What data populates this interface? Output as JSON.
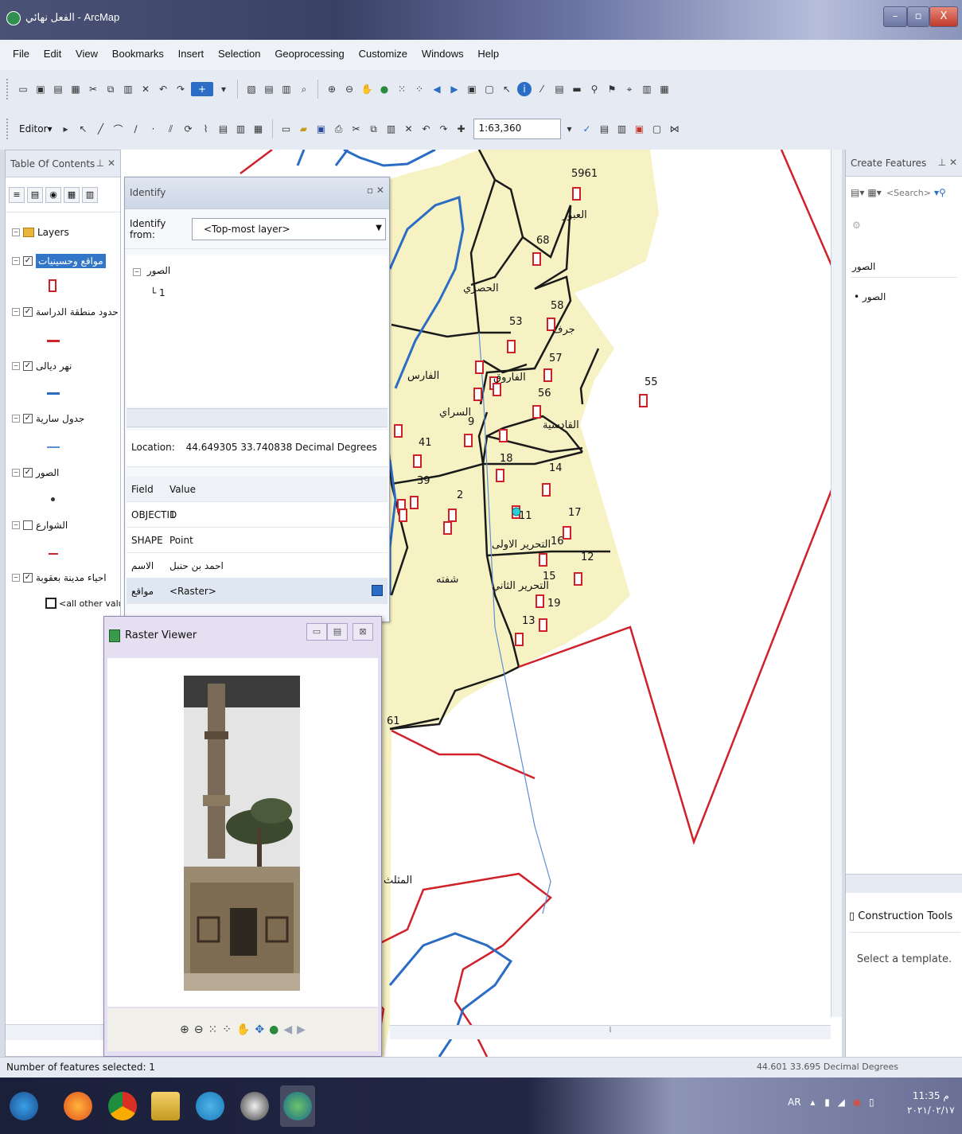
{
  "window": {
    "title": "الفعل نهائي - ArcMap",
    "minimize": "–",
    "maximize": "▫",
    "close": "X"
  },
  "menu": [
    "File",
    "Edit",
    "View",
    "Bookmarks",
    "Insert",
    "Selection",
    "Geoprocessing",
    "Customize",
    "Windows",
    "Help"
  ],
  "toolbar": {
    "editor_label": "Editor▾",
    "scale": "1:63,360"
  },
  "toc": {
    "title": "Table Of Contents",
    "root": "Layers",
    "layers": [
      {
        "name": "مواقع وحسينيات",
        "checked": true,
        "symbol": "red-marker"
      },
      {
        "name": "حدود منطقة الدراسة",
        "checked": true,
        "symbol": "red-line"
      },
      {
        "name": "نهر ديالى",
        "checked": true,
        "symbol": "blue-line"
      },
      {
        "name": "جدول سارية",
        "checked": true,
        "symbol": "blue-thin-line"
      },
      {
        "name": "الصور",
        "checked": true,
        "symbol": "dot"
      },
      {
        "name": "الشوارع",
        "checked": false,
        "symbol": "red-short-line"
      },
      {
        "name": "احياء مدينة بعقوبة",
        "checked": true,
        "symbol": "polygon"
      }
    ],
    "other_values": "<all other values>"
  },
  "identify": {
    "title": "Identify",
    "from_label": "Identify from:",
    "from_value": "<Top-most layer>",
    "tree_root": "الصور",
    "tree_child": "1",
    "location_label": "Location:",
    "location_value": "44.649305  33.740838 Decimal Degrees",
    "columns": [
      "Field",
      "Value"
    ],
    "rows": [
      {
        "field": "OBJECTID",
        "value": "1"
      },
      {
        "field": "SHAPE",
        "value": "Point"
      },
      {
        "field": "الاسم",
        "value": "احمد بن حنبل"
      },
      {
        "field": "مواقع",
        "value": "<Raster>"
      }
    ]
  },
  "raster_viewer": {
    "title": "Raster Viewer"
  },
  "create_features": {
    "title": "Create Features",
    "search_placeholder": "<Search>",
    "layer_group": "الصور",
    "layer_item": "الصور",
    "construction_tools": "Construction Tools",
    "select_template": "Select a template."
  },
  "map": {
    "labels": [
      {
        "text": "5961"
      },
      {
        "text": "العبور"
      },
      {
        "text": "68"
      },
      {
        "text": "الحصري"
      },
      {
        "text": "58"
      },
      {
        "text": "جرف"
      },
      {
        "text": "53"
      },
      {
        "text": "57"
      },
      {
        "text": "الفارس"
      },
      {
        "text": "الفاروق"
      },
      {
        "text": "56"
      },
      {
        "text": "55"
      },
      {
        "text": "السراي"
      },
      {
        "text": "القادسية"
      },
      {
        "text": "41"
      },
      {
        "text": "9"
      },
      {
        "text": "18"
      },
      {
        "text": "14"
      },
      {
        "text": "39"
      },
      {
        "text": "2"
      },
      {
        "text": "11"
      },
      {
        "text": "17"
      },
      {
        "text": "التحرير الاولى"
      },
      {
        "text": "16"
      },
      {
        "text": "12"
      },
      {
        "text": "شفته"
      },
      {
        "text": "التحرير الثاني"
      },
      {
        "text": "15"
      },
      {
        "text": "19"
      },
      {
        "text": "13"
      },
      {
        "text": "61"
      },
      {
        "text": "المثلث"
      }
    ]
  },
  "status": {
    "left": "Number of features selected: 1",
    "right": "44.601  33.695 Decimal Degrees"
  },
  "taskbar": {
    "tray_lang": "AR",
    "time": "11:35 م",
    "date": "٢٠٢١/٠٢/١٧"
  }
}
